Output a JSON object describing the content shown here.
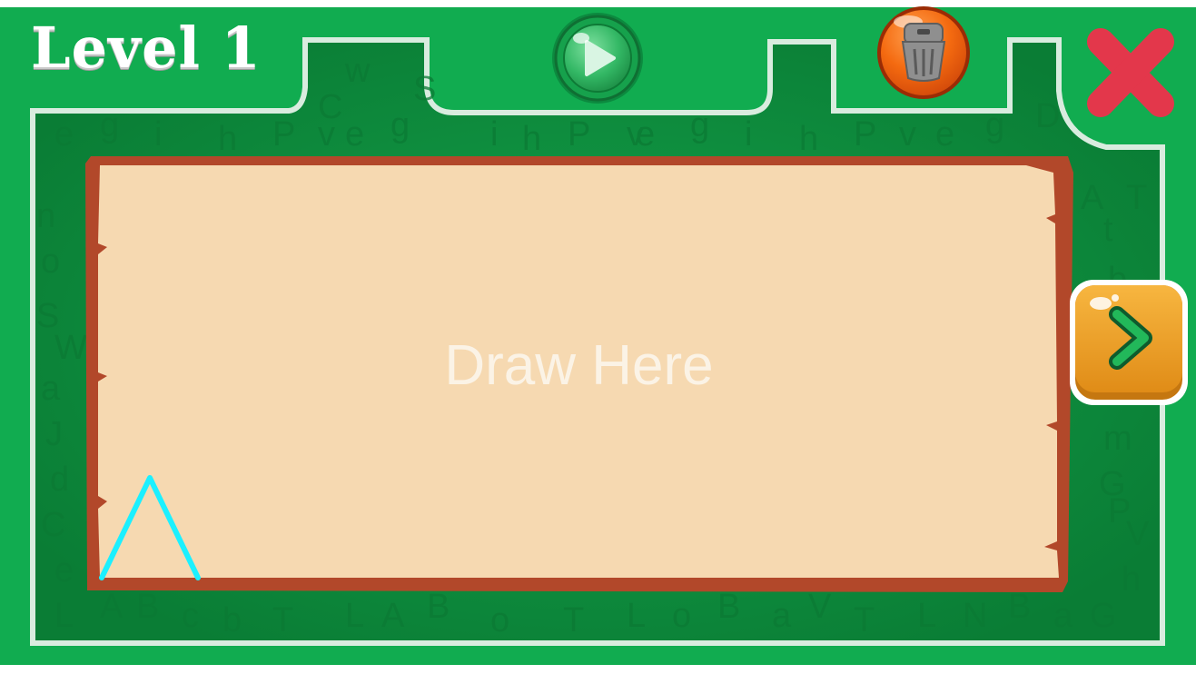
{
  "header": {
    "level_label": "Level 1"
  },
  "canvas": {
    "hint": "Draw Here"
  },
  "controls": {
    "play_icon": "play-icon",
    "trash_icon": "trash-icon",
    "close_icon": "close-icon",
    "next_icon": "chevron-right-icon"
  },
  "colors": {
    "background_green": "#11ac50",
    "inner_green": "#0c8f3e",
    "board_fill": "#f6d9b1",
    "board_frame": "#b2482a",
    "close_red": "#e3374b",
    "trash_orange": "#f0620e",
    "next_orange": "#f0a52a",
    "stroke_cyan": "#1cf0ff"
  },
  "decor_letters": [
    "e",
    "g",
    "i",
    "h",
    "P",
    "v",
    "e",
    "g",
    "C",
    "S",
    "B",
    "T",
    "J",
    "d",
    "m",
    "G",
    "A",
    "t",
    "r",
    "b",
    "a",
    "V",
    "W",
    "s",
    "o"
  ]
}
